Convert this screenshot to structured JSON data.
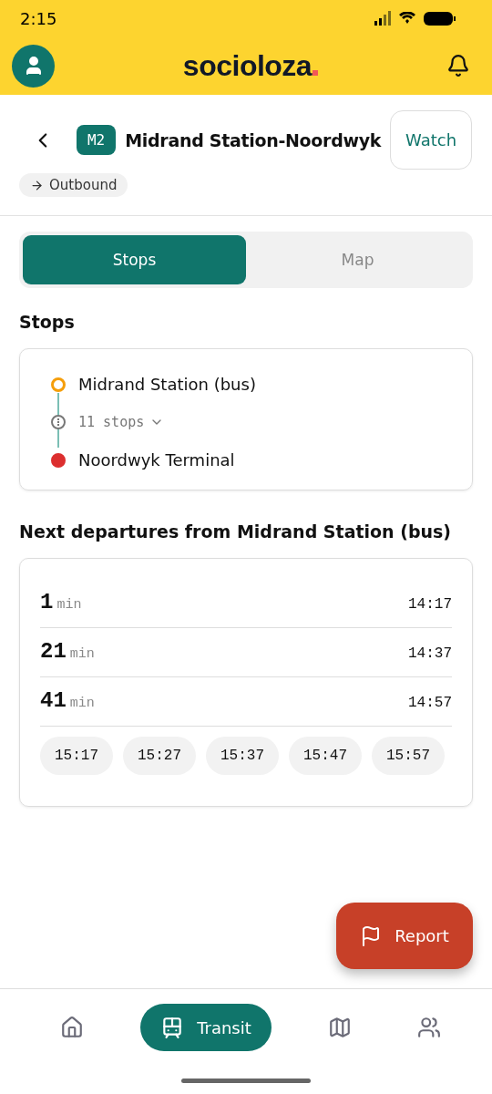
{
  "status_bar": {
    "time": "2:15"
  },
  "app_bar": {
    "logo": "socioloza"
  },
  "route": {
    "badge": "M2",
    "title": "Midrand Station-Noordwyk",
    "watch_button": "Watch",
    "direction": "Outbound"
  },
  "tabs": [
    {
      "label": "Stops",
      "selected": true
    },
    {
      "label": "Map",
      "selected": false
    }
  ],
  "stops_heading": "Stops",
  "stops": [
    {
      "kind": "origin",
      "name": "Midrand Station (bus)",
      "color": "#f59e0b"
    },
    {
      "kind": "collapsed",
      "name": "11 stops",
      "expanded": false
    },
    {
      "kind": "destination",
      "name": "Noordwyk Terminal",
      "color": "#dc2f2f"
    }
  ],
  "departures_heading": "Next departures from Midrand Station (bus)",
  "departures": [
    {
      "minutes": "1",
      "unit": "min",
      "time": "14:17"
    },
    {
      "minutes": "21",
      "unit": "min",
      "time": "14:37"
    },
    {
      "minutes": "41",
      "unit": "min",
      "time": "14:57"
    }
  ],
  "later_times": [
    "15:17",
    "15:27",
    "15:37",
    "15:47",
    "15:57"
  ],
  "report_button": "Report",
  "bottom_nav": [
    {
      "kind": "home",
      "selected": false
    },
    {
      "kind": "transit",
      "label": "Transit",
      "selected": true
    },
    {
      "kind": "map",
      "selected": false
    },
    {
      "kind": "people",
      "selected": false
    }
  ]
}
